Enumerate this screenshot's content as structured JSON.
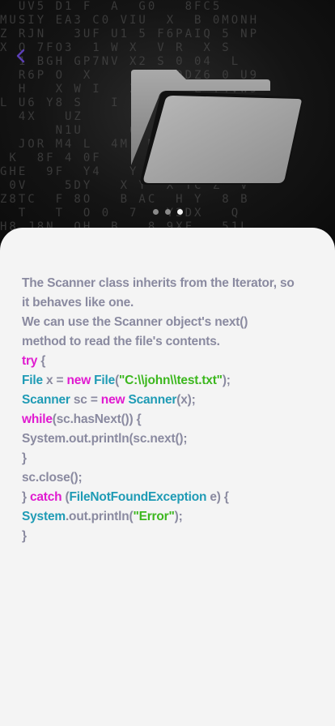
{
  "colors": {
    "keyword": "#e01bd0",
    "type": "#1f9bb5",
    "string": "#3cb71e",
    "text": "#8a8aa0",
    "background": "#f4f4f4"
  },
  "hero": {
    "back_icon": "chevron-left-icon",
    "illustration": "folder-icon",
    "matrix_rows": [
      "  UV5 D1 F  A  G0   8FC5   ",
      "MUSIY EA3 C0 VIU  X  B 0MONH",
      "Z RJN   3UF U1 5 F6PAIQ 5 NP",
      "X O 7FO3  1 W X  V R  X S  ",
      "  1 BGH GP7NV X2 S 0 04  L  ",
      "  R6P O  X     6   0DZ6 0 U9",
      "  H   X W I   ZU  A  L Y4VW9",
      "L U6 Y8 S   I         B  C4",
      "  4X   UZ         B   Q 7 8",
      "      N1U     0   X   T 6  ",
      "  JOR M4 L  4M  M4PH1  H  4",
      " K  8F 4 0F        WH4 P  Q",
      "GHE  9F  Y4   Y M3 Z   F  B",
      " 0V    5DY   X Y  X YC Z  V",
      "Z8TC  F 8O   B AC  H Y  8 B",
      "  T   T  O 0  7   Y3DX   Q ",
      "H8 J8N  OH  B   8 9XF   51L"
    ],
    "pager_dots": 3,
    "pager_active_index": 2
  },
  "lines": [
    [
      {
        "t": "The Scanner class inherits from the Iterator, so",
        "c": "tx"
      }
    ],
    [
      {
        "t": "it behaves like one.",
        "c": "tx"
      }
    ],
    [
      {
        "t": "We can use the Scanner object's next()",
        "c": "tx"
      }
    ],
    [
      {
        "t": "method to read the file's contents.",
        "c": "tx"
      }
    ],
    [
      {
        "t": "try",
        "c": "kw"
      },
      {
        "t": " {",
        "c": "tx"
      }
    ],
    [
      {
        "t": "File",
        "c": "ty"
      },
      {
        "t": " x = ",
        "c": "tx"
      },
      {
        "t": "new",
        "c": "kw"
      },
      {
        "t": " ",
        "c": "tx"
      },
      {
        "t": "File",
        "c": "ty"
      },
      {
        "t": "(",
        "c": "tx"
      },
      {
        "t": "\"C:\\\\john\\\\test.txt\"",
        "c": "str"
      },
      {
        "t": ");",
        "c": "tx"
      }
    ],
    [
      {
        "t": "Scanner",
        "c": "ty"
      },
      {
        "t": " sc = ",
        "c": "tx"
      },
      {
        "t": "new",
        "c": "kw"
      },
      {
        "t": " ",
        "c": "tx"
      },
      {
        "t": "Scanner",
        "c": "ty"
      },
      {
        "t": "(x);",
        "c": "tx"
      }
    ],
    [
      {
        "t": "while",
        "c": "kw"
      },
      {
        "t": "(sc.hasNext()) {",
        "c": "tx"
      }
    ],
    [
      {
        "t": "System.out.println(sc.next();",
        "c": "tx"
      }
    ],
    [
      {
        "t": "}",
        "c": "tx"
      }
    ],
    [
      {
        "t": "sc.close();",
        "c": "tx"
      }
    ],
    [
      {
        "t": "} ",
        "c": "tx"
      },
      {
        "t": "catch",
        "c": "kw"
      },
      {
        "t": " (",
        "c": "tx"
      },
      {
        "t": "FileNotFoundException",
        "c": "ty"
      },
      {
        "t": " e) {",
        "c": "tx"
      }
    ],
    [
      {
        "t": "System",
        "c": "ty"
      },
      {
        "t": ".out.println(",
        "c": "tx"
      },
      {
        "t": "\"Error\"",
        "c": "str"
      },
      {
        "t": ");",
        "c": "tx"
      }
    ],
    [
      {
        "t": "}",
        "c": "tx"
      }
    ]
  ]
}
